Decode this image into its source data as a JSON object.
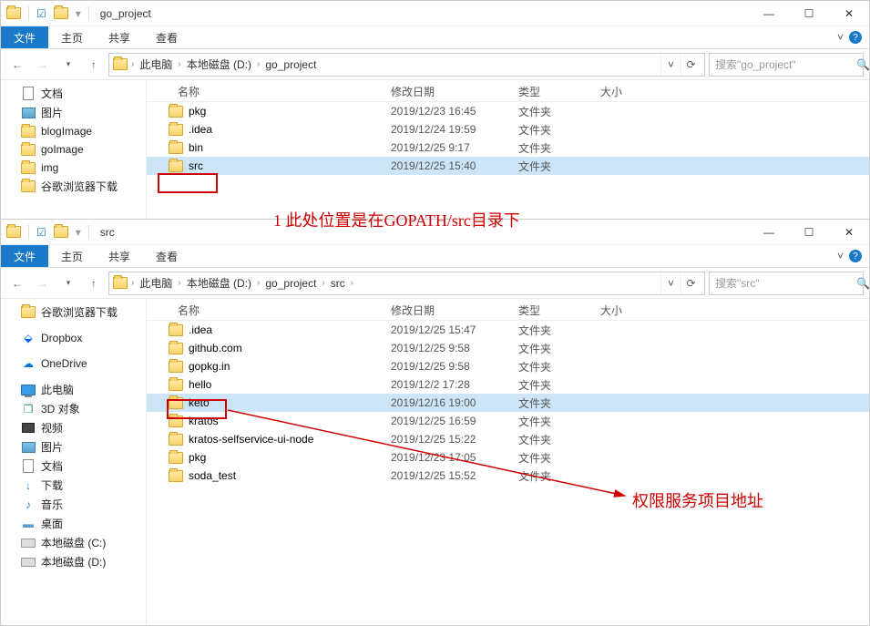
{
  "window1": {
    "title": "go_project",
    "tabs": {
      "file": "文件",
      "home": "主页",
      "share": "共享",
      "view": "查看"
    },
    "nav": {
      "crumbs": [
        "此电脑",
        "本地磁盘 (D:)",
        "go_project"
      ],
      "search_placeholder": "搜索\"go_project\""
    },
    "columns": {
      "name": "名称",
      "date": "修改日期",
      "type": "类型",
      "size": "大小"
    },
    "tree": [
      {
        "icon": "doc",
        "label": "文档"
      },
      {
        "icon": "pic",
        "label": "图片"
      },
      {
        "icon": "folder",
        "label": "blogImage"
      },
      {
        "icon": "folder",
        "label": "goImage"
      },
      {
        "icon": "folder",
        "label": "img"
      },
      {
        "icon": "folder",
        "label": "谷歌浏览器下载"
      }
    ],
    "rows": [
      {
        "name": "pkg",
        "date": "2019/12/23 16:45",
        "type": "文件夹",
        "selected": false
      },
      {
        "name": ".idea",
        "date": "2019/12/24 19:59",
        "type": "文件夹",
        "selected": false
      },
      {
        "name": "bin",
        "date": "2019/12/25 9:17",
        "type": "文件夹",
        "selected": false
      },
      {
        "name": "src",
        "date": "2019/12/25 15:40",
        "type": "文件夹",
        "selected": true
      }
    ]
  },
  "window2": {
    "title": "src",
    "tabs": {
      "file": "文件",
      "home": "主页",
      "share": "共享",
      "view": "查看"
    },
    "nav": {
      "crumbs": [
        "此电脑",
        "本地磁盘 (D:)",
        "go_project",
        "src"
      ],
      "search_placeholder": "搜索\"src\""
    },
    "columns": {
      "name": "名称",
      "date": "修改日期",
      "type": "类型",
      "size": "大小"
    },
    "tree": [
      {
        "icon": "folder",
        "label": "谷歌浏览器下载"
      },
      {
        "icon": "spacer"
      },
      {
        "icon": "dropbox",
        "label": "Dropbox"
      },
      {
        "icon": "spacer"
      },
      {
        "icon": "onedrive",
        "label": "OneDrive"
      },
      {
        "icon": "spacer"
      },
      {
        "icon": "pc",
        "label": "此电脑"
      },
      {
        "icon": "cube",
        "label": "3D 对象"
      },
      {
        "icon": "video",
        "label": "视频"
      },
      {
        "icon": "pic",
        "label": "图片"
      },
      {
        "icon": "doc",
        "label": "文档"
      },
      {
        "icon": "download",
        "label": "下载"
      },
      {
        "icon": "music",
        "label": "音乐"
      },
      {
        "icon": "desktop",
        "label": "桌面"
      },
      {
        "icon": "drive",
        "label": "本地磁盘 (C:)"
      },
      {
        "icon": "drive",
        "label": "本地磁盘 (D:)"
      }
    ],
    "rows": [
      {
        "name": ".idea",
        "date": "2019/12/25 15:47",
        "type": "文件夹",
        "selected": false
      },
      {
        "name": "github.com",
        "date": "2019/12/25 9:58",
        "type": "文件夹",
        "selected": false
      },
      {
        "name": "gopkg.in",
        "date": "2019/12/25 9:58",
        "type": "文件夹",
        "selected": false
      },
      {
        "name": "hello",
        "date": "2019/12/2 17:28",
        "type": "文件夹",
        "selected": false
      },
      {
        "name": "keto",
        "date": "2019/12/16 19:00",
        "type": "文件夹",
        "selected": true
      },
      {
        "name": "kratos",
        "date": "2019/12/25 16:59",
        "type": "文件夹",
        "selected": false
      },
      {
        "name": "kratos-selfservice-ui-node",
        "date": "2019/12/25 15:22",
        "type": "文件夹",
        "selected": false
      },
      {
        "name": "pkg",
        "date": "2019/12/23 17:05",
        "type": "文件夹",
        "selected": false
      },
      {
        "name": "soda_test",
        "date": "2019/12/25 15:52",
        "type": "文件夹",
        "selected": false
      }
    ]
  },
  "annotations": {
    "text1": "1 此处位置是在GOPATH/src目录下",
    "text2": "权限服务项目地址"
  }
}
